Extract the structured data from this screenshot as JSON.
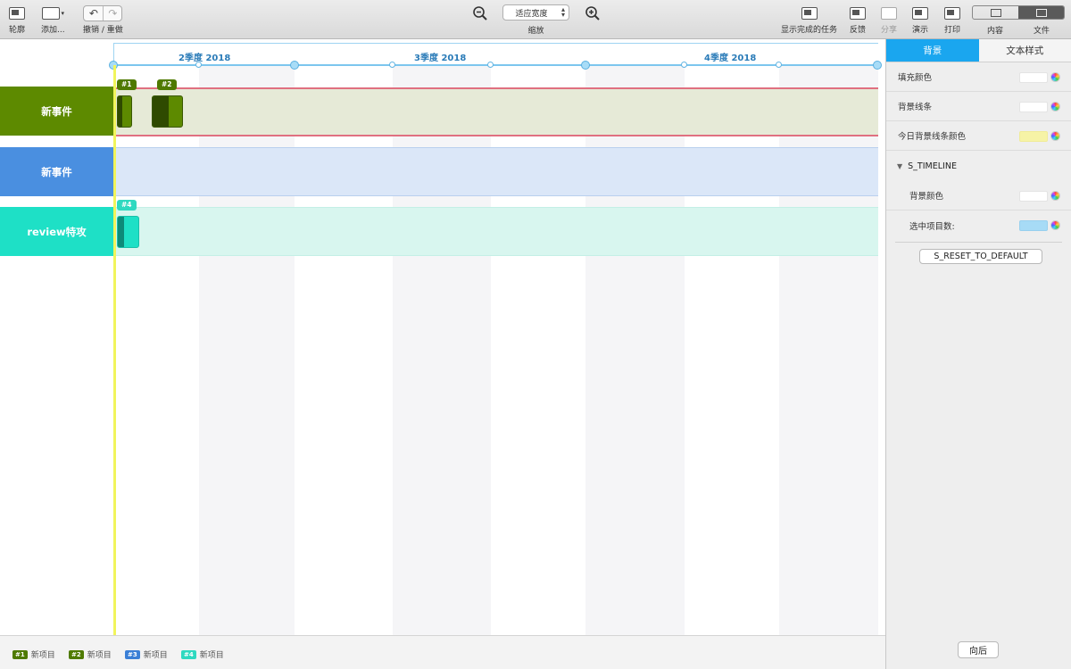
{
  "toolbar": {
    "outline_label": "轮廓",
    "add_label": "添加...",
    "undo_redo_label": "撤销 / 重做",
    "zoom_value": "适应宽度",
    "zoom_label": "缩放",
    "show_completed_label": "显示完成的任务",
    "feedback_label": "反馈",
    "share_label": "分享",
    "present_label": "演示",
    "print_label": "打印",
    "content_label": "内容",
    "file_label": "文件"
  },
  "timeline": {
    "quarters": [
      "2季度 2018",
      "3季度 2018",
      "4季度 2018"
    ]
  },
  "rows": [
    {
      "label": "新事件",
      "color": "#5d8a00",
      "band_color": "#e6ead7",
      "border_color": "#e06070"
    },
    {
      "label": "新事件",
      "color": "#4a8fe0",
      "band_color": "#dbe7f8",
      "border_color": "#b9d0ee"
    },
    {
      "label": "review特攻",
      "color": "#1ee0c6",
      "band_color": "#d8f6ef",
      "border_color": "#c4efe6"
    }
  ],
  "items": [
    {
      "tag": "#1",
      "color": "#5d8a00",
      "dark": "#2f4a00"
    },
    {
      "tag": "#2",
      "color": "#5d8a00",
      "dark": "#2f4a00"
    },
    {
      "tag": "#4",
      "color": "#1ee0c6",
      "dark": "#0d8a78"
    }
  ],
  "legend": [
    {
      "tag": "#1",
      "label": "新项目",
      "color": "#4f7a00"
    },
    {
      "tag": "#2",
      "label": "新项目",
      "color": "#4f7a00"
    },
    {
      "tag": "#3",
      "label": "新项目",
      "color": "#3a7fd6"
    },
    {
      "tag": "#4",
      "label": "新项目",
      "color": "#2fd9c0"
    }
  ],
  "inspector": {
    "tab_background": "背景",
    "tab_text_style": "文本样式",
    "fill_color": "填充颜色",
    "bg_lines": "背景线条",
    "today_line_color": "今日背景线条颜色",
    "section_title": "S_TIMELINE",
    "bg_color": "背景颜色",
    "selected_count": "选中项目数:",
    "reset_button": "S_RESET_TO_DEFAULT",
    "back_button": "向后",
    "today_swatch": "#f6f3a6",
    "selected_swatch": "#a7dbf6"
  }
}
